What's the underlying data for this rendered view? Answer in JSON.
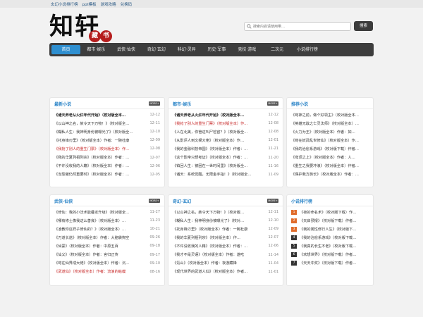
{
  "toplinks": [
    "玄幻小说排行榜",
    "ppt模板",
    "游戏攻略",
    "兑换码"
  ],
  "logo": {
    "main1": "知",
    "main2": "轩",
    "seal1": "藏",
    "seal2": "书"
  },
  "search": {
    "placeholder": "搜索内容请使用带…",
    "button": "搜索"
  },
  "nav": [
    "首页",
    "都市·娱乐",
    "武侠·仙侠",
    "奇幻·玄幻",
    "科幻·灵异",
    "历史·军事",
    "竞技·游戏",
    "二次元",
    "小说排行榜"
  ],
  "more_label": "MORE+",
  "panels": {
    "latest": {
      "title": "最新小说",
      "rows": [
        {
          "t": "《诸天养老从火红年代开始》（校对版全本…",
          "d": "12-12",
          "s": "bold"
        },
        {
          "t": "《以山神之名，赦令天下万物！》（校对版全…",
          "d": "12-11",
          "s": ""
        },
        {
          "t": "《糊私人生：我神明身份被曝光了》（校对版全…",
          "d": "12-10",
          "s": ""
        },
        {
          "t": "《托身锋刃里》（校对版全本）作者：一碗杜康",
          "d": "12-09",
          "s": ""
        },
        {
          "t": "《我抢了别人的重生门票》（校对版全本）作…",
          "d": "12-08",
          "s": "red"
        },
        {
          "t": "《我的华夏列祖列宗》（校对版全本）作者：…",
          "d": "12-07",
          "s": ""
        },
        {
          "t": "《不许没收我的人籍》（校对版全本）作者：…",
          "d": "12-06",
          "s": ""
        },
        {
          "t": "《当惩傲仍然重要时》（校对版全本）作者：…",
          "d": "12-05",
          "s": ""
        }
      ]
    },
    "urban": {
      "title": "都市·娱乐",
      "rows": [
        {
          "t": "《诸天养老从火红年代开始》（校对版全本…",
          "d": "12-12",
          "s": "bold"
        },
        {
          "t": "《我抢了别人的重生门票》（校对版全本）作…",
          "d": "12-08",
          "s": "red"
        },
        {
          "t": "《人在北美，你管这叫尸检官？》（校对版全…",
          "d": "12-08",
          "s": ""
        },
        {
          "t": "《从影评人到文娱大佬》（校对版全本）作…",
          "d": "12-01",
          "s": ""
        },
        {
          "t": "《我的金融科技帝国》（校对版全本）作者：…",
          "d": "11-21",
          "s": ""
        },
        {
          "t": "《这个影帝只想考证》（校对版全本）作者：…",
          "d": "11-20",
          "s": ""
        },
        {
          "t": "《铂回人生：被困在一世时间里》（校对版全…",
          "d": "11-16",
          "s": ""
        },
        {
          "t": "《诸天：系统觉醒，无限金手指！》（校对版全…",
          "d": "11-09",
          "s": ""
        }
      ]
    },
    "recommend": {
      "title": "推荐小说",
      "rows": [
        {
          "t": "《苟神之前，做个好领主》（校对版全本…",
          "s": ""
        },
        {
          "t": "《英雄无敌之亡灵法师》（校对版全本）…",
          "s": ""
        },
        {
          "t": "《火力为王》（校对版全本）作者：如…",
          "s": ""
        },
        {
          "t": "《苟在妖武乱世修仙》（校对版全本）作…",
          "s": ""
        },
        {
          "t": "《我的治愈系游戏》（校对版下载）作者…",
          "s": ""
        },
        {
          "t": "《穹顶之上》（校对版全本）作者：人…",
          "s": ""
        },
        {
          "t": "《重生之我要冲浪》（校对版全本）作者…",
          "s": ""
        },
        {
          "t": "《保护我方族长》（校对版全本）作者：…",
          "s": ""
        }
      ]
    },
    "wuxia": {
      "title": "武侠·仙侠",
      "rows": [
        {
          "t": "《修仙：我的小法术能叠定升级》（校对版全…",
          "d": "11-27",
          "s": ""
        },
        {
          "t": "《哪有修士像我这么善良》（校对版全本）…",
          "d": "11-23",
          "s": ""
        },
        {
          "t": "《凌教你这样子修仙的？》（校对版全本）…",
          "d": "10-21",
          "s": ""
        },
        {
          "t": "《万道长途》（校对版全本）作者：大脑袋掏空",
          "d": "09-26",
          "s": ""
        },
        {
          "t": "《仙蒙》（校对版全本）作者：中原五百",
          "d": "09-18",
          "s": ""
        },
        {
          "t": "《仙父》（校对版全本）作者：言归正传",
          "d": "09-17",
          "s": ""
        },
        {
          "t": "《苟在仙界成大佬》（校对版全本）作者：沉…",
          "d": "09-10",
          "s": ""
        },
        {
          "t": "《武道仙》（校对版全本）作者：流浪的蛤蟆",
          "d": "08-16",
          "s": "red"
        }
      ]
    },
    "fantasy": {
      "title": "奇幻·玄幻",
      "rows": [
        {
          "t": "《以山神之名，赦令天下万物！》（校对版…",
          "d": "12-11",
          "s": ""
        },
        {
          "t": "《糊私人生：我神明身份被曝光了》（校对…",
          "d": "12-10",
          "s": ""
        },
        {
          "t": "《托身锋刃里》（校对版全本）作者：一碗杜康",
          "d": "12-09",
          "s": ""
        },
        {
          "t": "《我的华夏列祖列宗》（校对版全本）作…",
          "d": "12-07",
          "s": ""
        },
        {
          "t": "《不许没收我的人籍》（校对版全本）作者：…",
          "d": "12-06",
          "s": ""
        },
        {
          "t": "《我才不是灵语》（校对版全本）作者：遂吃",
          "d": "11-14",
          "s": ""
        },
        {
          "t": "《氖山》（校对版全本）作者：夜游藏锋",
          "d": "11-04",
          "s": ""
        },
        {
          "t": "《现代世界的武道人仙》（校对版全本）作者…",
          "d": "11-01",
          "s": ""
        }
      ]
    },
    "ranking": {
      "title": "小说排行榜",
      "rows": [
        {
          "n": "1",
          "t": "《夜的命名术》（校对版下载）作…"
        },
        {
          "n": "2",
          "t": "《天启预报》（校对版下载）作者…"
        },
        {
          "n": "3",
          "t": "《我的属性修行人生》（校对版下…"
        },
        {
          "n": "4",
          "t": "《我的治愈系游戏》（校对版下载…"
        },
        {
          "n": "5",
          "t": "《我真的长生不老》（校对版下载…"
        },
        {
          "n": "6",
          "t": "《欢想世界》（校对版下载）作者…"
        },
        {
          "n": "7",
          "t": "《天天中奖》（校对版下载）作者…"
        }
      ]
    }
  }
}
